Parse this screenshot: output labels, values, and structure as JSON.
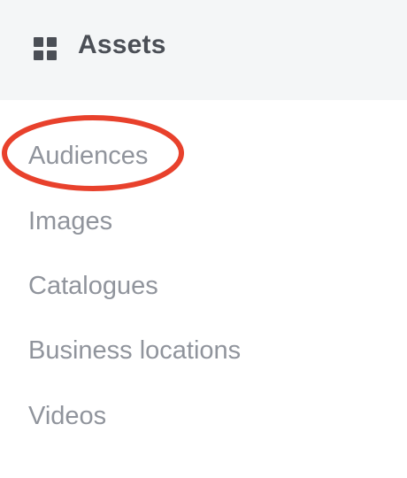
{
  "header": {
    "title": "Assets",
    "icon": "grid-icon"
  },
  "menu": {
    "items": [
      {
        "label": "Audiences",
        "highlighted": true
      },
      {
        "label": "Images"
      },
      {
        "label": "Catalogues"
      },
      {
        "label": "Business locations"
      },
      {
        "label": "Videos"
      }
    ]
  },
  "colors": {
    "header_bg": "#f4f6f7",
    "header_text": "#4b4f56",
    "menu_text": "#90949c",
    "highlight": "#e8412c"
  }
}
